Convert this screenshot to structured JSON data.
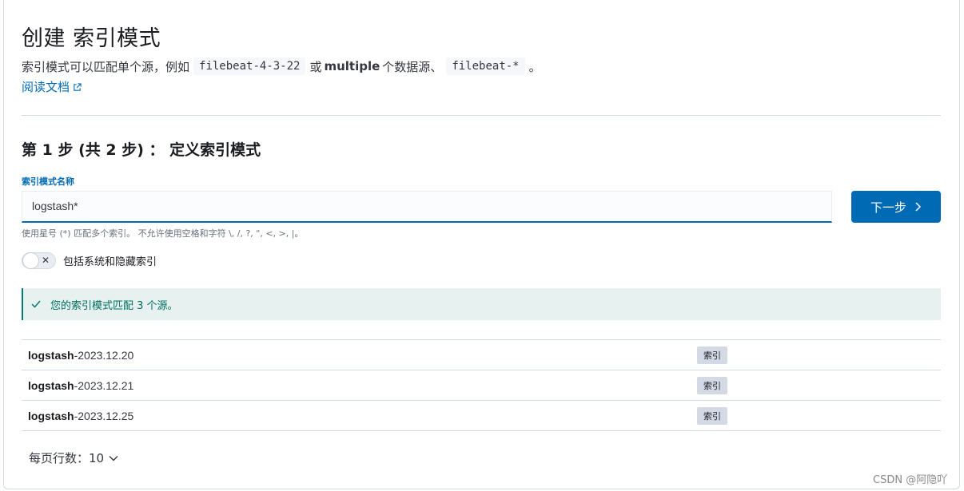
{
  "page": {
    "title": "创建 索引模式",
    "description_prefix": "索引模式可以匹配单个源，例如",
    "example_single": "filebeat-4-3-22",
    "description_or": "或",
    "description_multiple": "multiple",
    "description_middle": "个数据源、",
    "example_multiple": "filebeat-*",
    "description_end": "。",
    "doc_link": "阅读文档"
  },
  "step": {
    "title": "第 1 步 (共 2 步) ： 定义索引模式",
    "field_label": "索引模式名称",
    "input_value": "logstash*",
    "next_button": "下一步",
    "help_text": "使用星号 (*) 匹配多个索引。 不允许使用空格和字符 \\, /, ?, \", <, >, |。",
    "toggle_label": "包括系统和隐藏索引",
    "toggle_on": false
  },
  "callout": {
    "text": "您的索引模式匹配 3 个源。"
  },
  "results": [
    {
      "name_bold": "logstash",
      "name_rest": "-2023.12.20",
      "type": "索引"
    },
    {
      "name_bold": "logstash",
      "name_rest": "-2023.12.21",
      "type": "索引"
    },
    {
      "name_bold": "logstash",
      "name_rest": "-2023.12.25",
      "type": "索引"
    }
  ],
  "pager": {
    "label": "每页行数：10"
  },
  "watermark": "CSDN @阿隐吖",
  "colors": {
    "primary": "#006bb4",
    "success": "#017d73",
    "success_bg": "#e6f1f0"
  },
  "icons": [
    "external-link-icon",
    "chevron-right-icon",
    "close-icon",
    "check-icon",
    "chevron-down-icon"
  ]
}
